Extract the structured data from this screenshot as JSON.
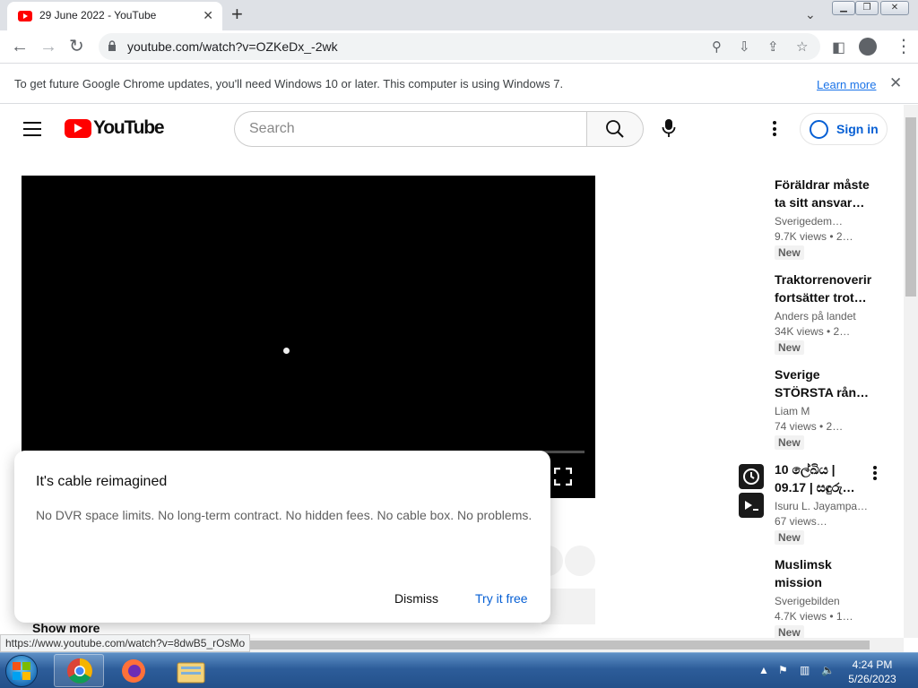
{
  "browser": {
    "tab_title": "29 June 2022 - YouTube",
    "url": "youtube.com/watch?v=OZKeDx_-2wk",
    "infobar_message": "To get future Google Chrome updates, you'll need Windows 10 or later. This computer is using Windows 7.",
    "infobar_link": "Learn more",
    "status_url": "https://www.youtube.com/watch?v=8dwB5_rOsMo"
  },
  "youtube": {
    "logo_text": "YouTube",
    "search_placeholder": "Search",
    "sign_in": "Sign in",
    "show_more": "Show more"
  },
  "dialog": {
    "heading": "It's cable reimagined",
    "body": "No DVR space limits. No long-term contract. No hidden fees. No cable box. No problems.",
    "dismiss": "Dismiss",
    "try": "Try it free"
  },
  "recommendations": [
    {
      "title_line1": "Föräldrar måste",
      "title_line2": "ta sitt ansvar…",
      "channel": "Sverigedem…",
      "views": "9.7K views  • 2…",
      "badge": "New"
    },
    {
      "title_line1": "Traktorrenoverir",
      "title_line2": "fortsätter trot…",
      "channel": "Anders på landet",
      "views": "34K views  • 2…",
      "badge": "New"
    },
    {
      "title_line1": "Sverige",
      "title_line2": "STÖRSTA rån…",
      "channel": "Liam M",
      "views": "74 views  • 2…",
      "badge": "New"
    },
    {
      "title_line1": "10 ලේඛිය |",
      "title_line2": "09.17 | සඳුරු…",
      "channel": "Isuru L. Jayampa…",
      "views": "67 views…",
      "badge": "New"
    },
    {
      "title_line1": "Muslimsk",
      "title_line2": "mission",
      "channel": "Sverigebilden",
      "views": "4.7K views  • 1…",
      "badge": "New"
    }
  ],
  "taskbar": {
    "time": "4:24 PM",
    "date": "5/26/2023"
  },
  "colors": {
    "youtube_red": "#ff0000",
    "link_blue": "#065fd4",
    "chrome_blue": "#1a73e8"
  }
}
